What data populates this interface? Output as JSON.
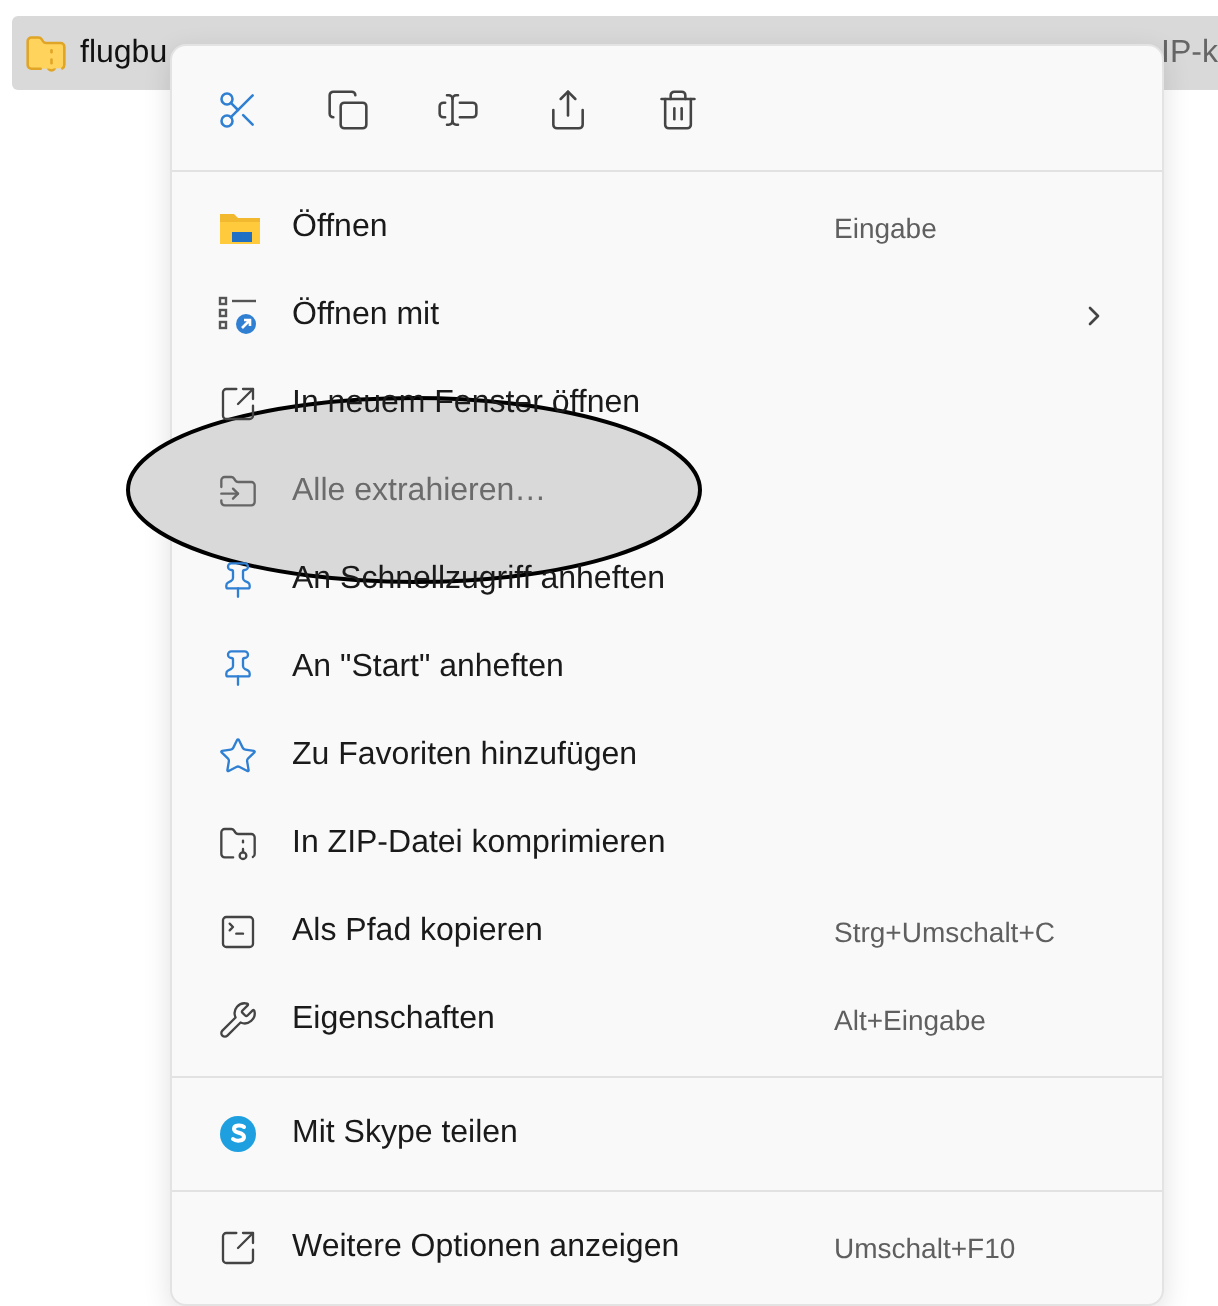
{
  "file_row": {
    "name": "flugbu",
    "trailing": "IP-k",
    "selected": true
  },
  "context_menu": {
    "sections": [
      [
        {
          "label": "Öffnen",
          "shortcut": "Eingabe",
          "has_submenu": false,
          "circled": false
        },
        {
          "label": "Öffnen mit",
          "has_submenu": true,
          "circled": false
        },
        {
          "label": "In neuem Fenster öffnen",
          "has_submenu": false,
          "circled": false
        },
        {
          "label": "Alle extrahieren…",
          "has_submenu": false,
          "circled": true
        },
        {
          "label": "An Schnellzugriff anheften",
          "has_submenu": false,
          "circled": false
        },
        {
          "label": "An \"Start\" anheften",
          "has_submenu": false,
          "circled": false
        },
        {
          "label": "Zu Favoriten hinzufügen",
          "has_submenu": false,
          "circled": false
        },
        {
          "label": "In ZIP-Datei komprimieren",
          "has_submenu": false,
          "circled": false
        },
        {
          "label": "Als Pfad kopieren",
          "shortcut": "Strg+Umschalt+C",
          "has_submenu": false,
          "circled": false
        },
        {
          "label": "Eigenschaften",
          "shortcut": "Alt+Eingabe",
          "has_submenu": false,
          "circled": false
        }
      ],
      [
        {
          "label": "Mit Skype teilen",
          "has_submenu": false,
          "circled": false
        }
      ],
      [
        {
          "label": "Weitere Optionen anzeigen",
          "shortcut": "Umschalt+F10",
          "has_submenu": false,
          "circled": false
        }
      ]
    ]
  }
}
